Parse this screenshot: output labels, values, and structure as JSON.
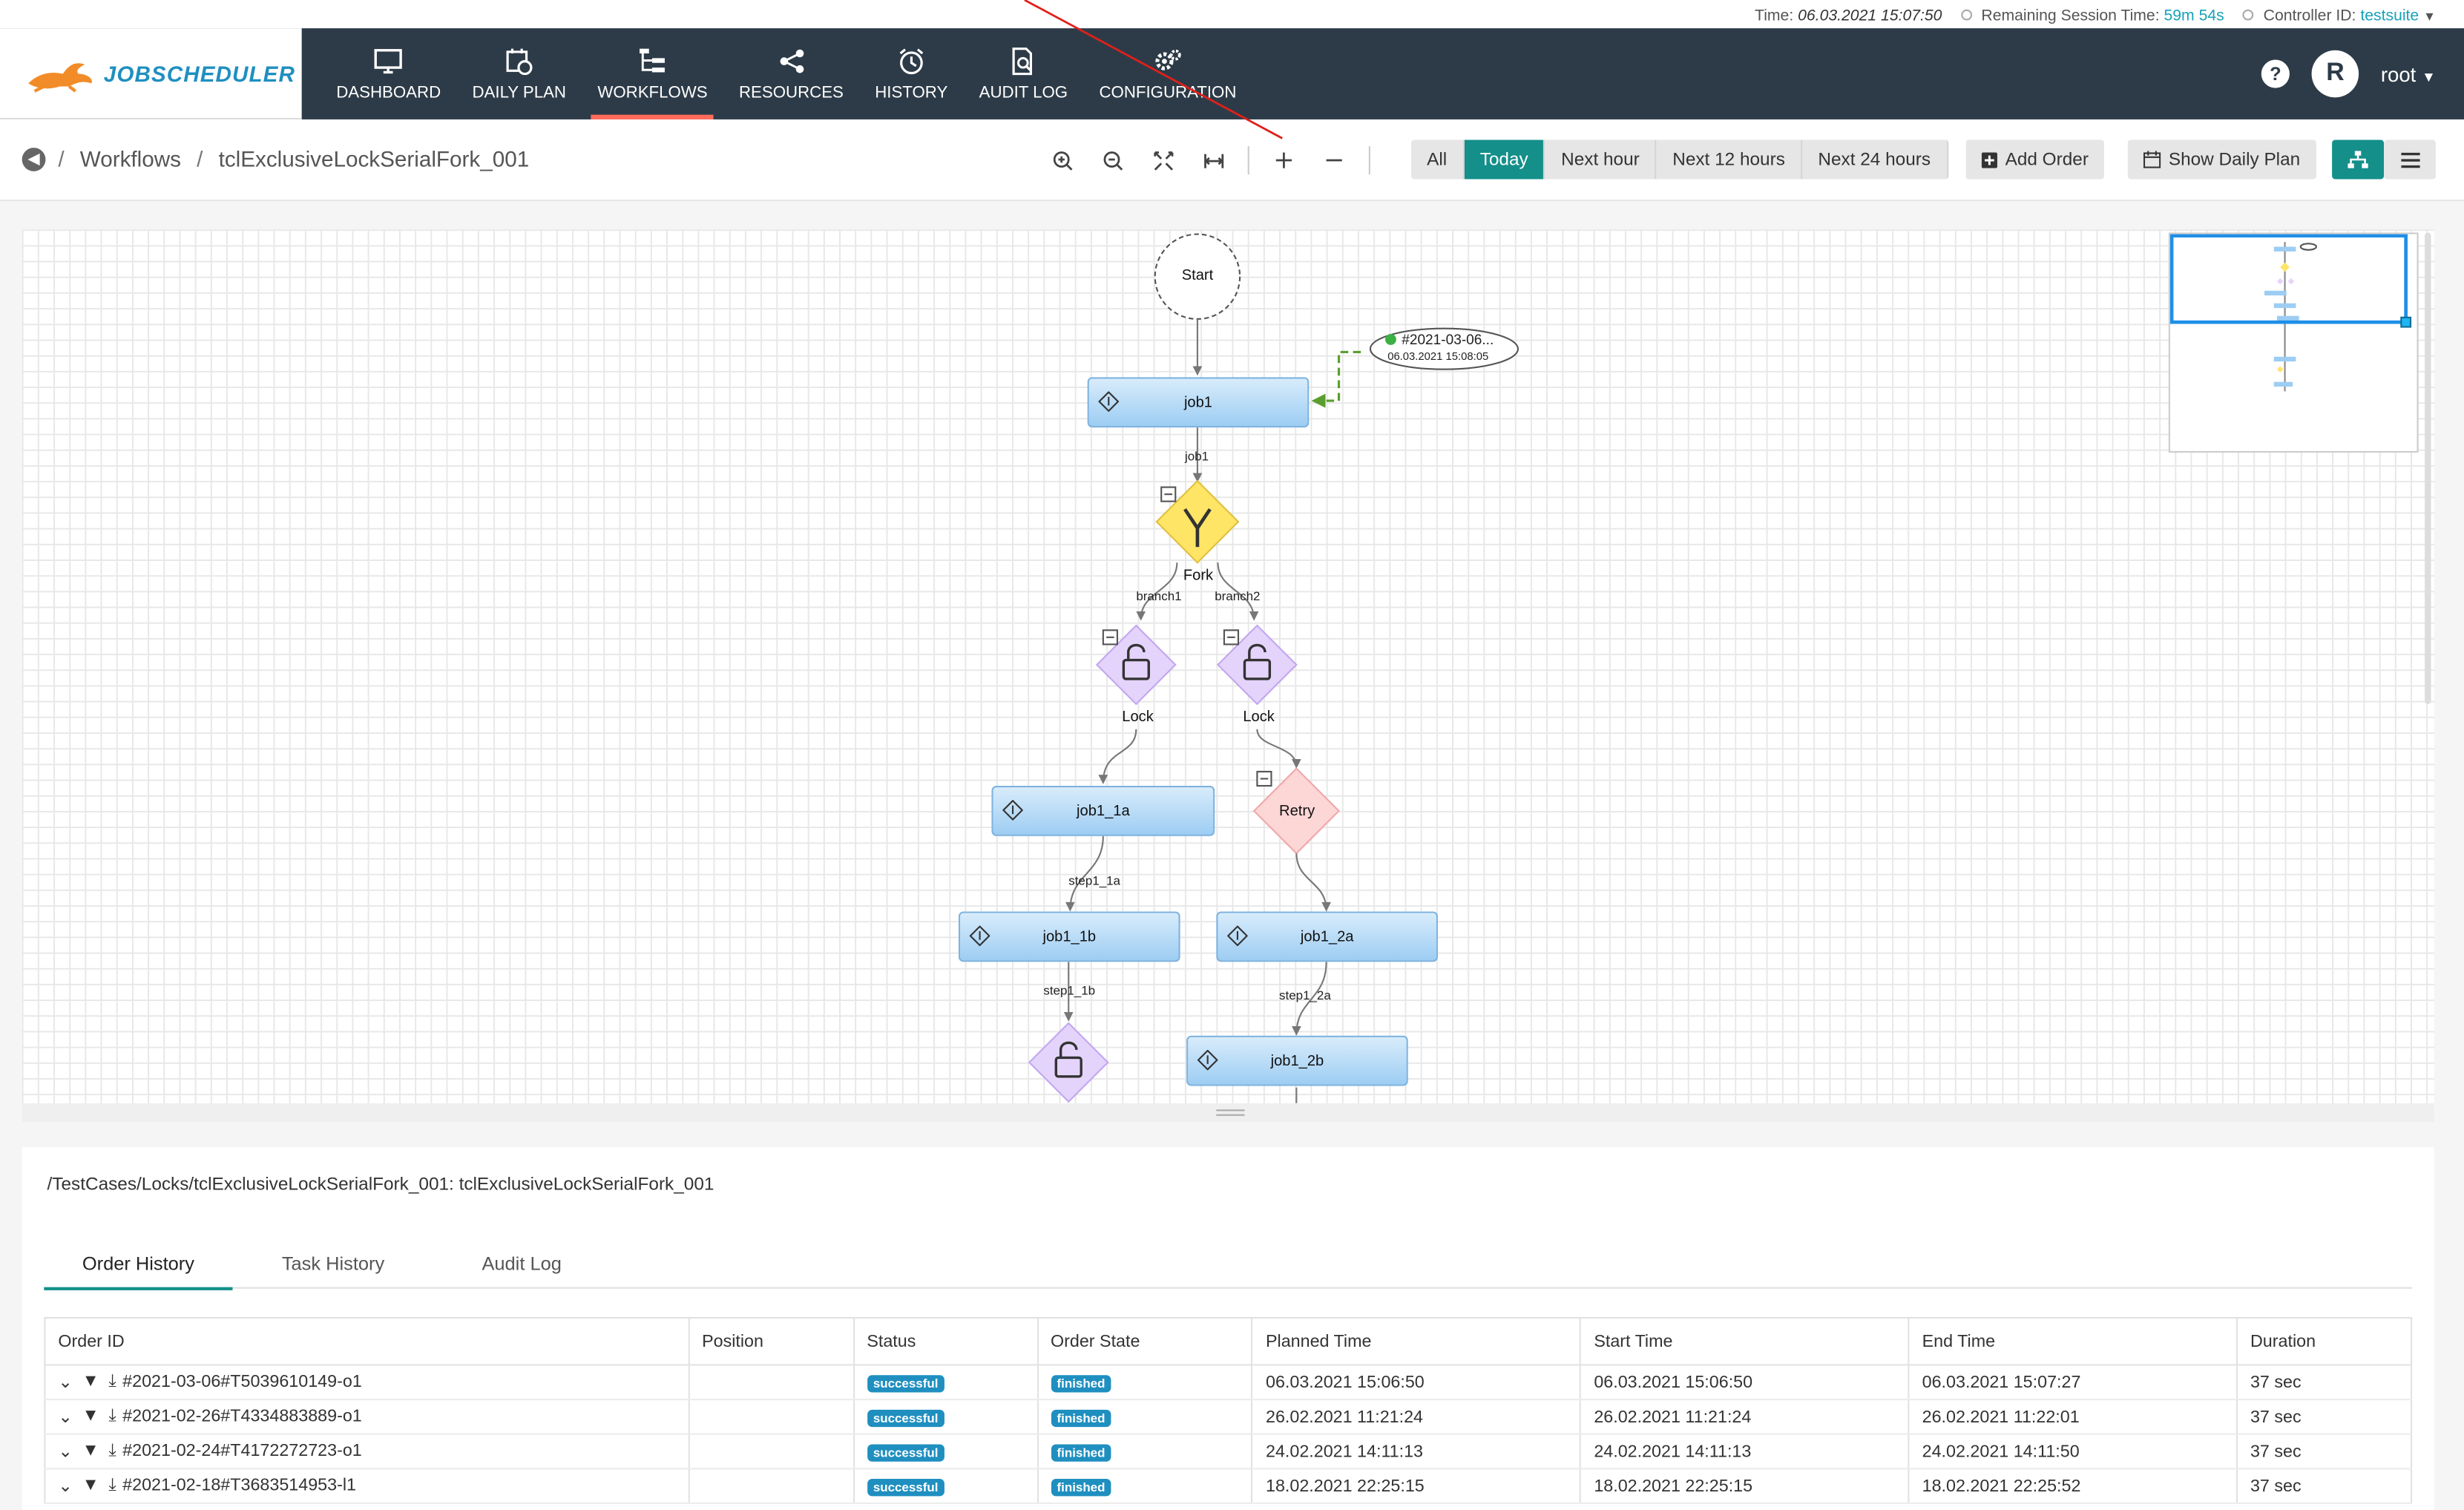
{
  "status_bar": {
    "time_label": "Time:",
    "time_value": "06.03.2021 15:07:50",
    "session_label": "Remaining Session Time:",
    "session_value": "59m 54s",
    "controller_label": "Controller ID:",
    "controller_value": "testsuite"
  },
  "brand": {
    "name": "JOBSCHEDULER",
    "accent": "#f28c28"
  },
  "nav": {
    "items": [
      {
        "label": "DASHBOARD",
        "icon": "monitor-icon"
      },
      {
        "label": "DAILY PLAN",
        "icon": "calendar-clock-icon"
      },
      {
        "label": "WORKFLOWS",
        "icon": "workflow-tree-icon",
        "active": true
      },
      {
        "label": "RESOURCES",
        "icon": "share-nodes-icon"
      },
      {
        "label": "HISTORY",
        "icon": "alarm-clock-icon"
      },
      {
        "label": "AUDIT LOG",
        "icon": "file-search-icon"
      },
      {
        "label": "CONFIGURATION",
        "icon": "gears-icon"
      }
    ],
    "help": "?",
    "avatar_initial": "R",
    "user": "root"
  },
  "breadcrumb": {
    "root": "Workflows",
    "current": "tclExclusiveLockSerialFork_001",
    "sep": "/"
  },
  "filters": [
    "All",
    "Today",
    "Next hour",
    "Next 12 hours",
    "Next 24 hours"
  ],
  "active_filter": "Today",
  "buttons": {
    "add_order": "Add Order",
    "show_daily_plan": "Show Daily Plan"
  },
  "graph": {
    "start": "Start",
    "order_id": "#2021-03-06...",
    "order_time": "06.03.2021 15:08:05",
    "jobs": {
      "job1": "job1",
      "job1_1a": "job1_1a",
      "job1_1b": "job1_1b",
      "job1_2a": "job1_2a",
      "job1_2b": "job1_2b"
    },
    "labels": {
      "edge_job1": "job1",
      "fork": "Fork",
      "branch1": "branch1",
      "branch2": "branch2",
      "lock1": "Lock",
      "lock2": "Lock",
      "retry": "Retry",
      "step1_1a": "step1_1a",
      "step1_1b": "step1_1b",
      "step1_2a": "step1_2a"
    }
  },
  "panel": {
    "path": "/TestCases/Locks/tclExclusiveLockSerialFork_001: tclExclusiveLockSerialFork_001",
    "tabs": [
      "Order History",
      "Task History",
      "Audit Log"
    ],
    "columns": [
      "Order ID",
      "Position",
      "Status",
      "Order State",
      "Planned Time",
      "Start Time",
      "End Time",
      "Duration"
    ],
    "rows": [
      {
        "id": "#2021-03-06#T5039610149-o1",
        "position": "",
        "status": "successful",
        "state": "finished",
        "planned": "06.03.2021 15:06:50",
        "start": "06.03.2021 15:06:50",
        "end": "06.03.2021 15:07:27",
        "duration": "37 sec"
      },
      {
        "id": "#2021-02-26#T4334883889-o1",
        "position": "",
        "status": "successful",
        "state": "finished",
        "planned": "26.02.2021 11:21:24",
        "start": "26.02.2021 11:21:24",
        "end": "26.02.2021 11:22:01",
        "duration": "37 sec"
      },
      {
        "id": "#2021-02-24#T4172272723-o1",
        "position": "",
        "status": "successful",
        "state": "finished",
        "planned": "24.02.2021 14:11:13",
        "start": "24.02.2021 14:11:13",
        "end": "24.02.2021 14:11:50",
        "duration": "37 sec"
      },
      {
        "id": "#2021-02-18#T3683514953-l1",
        "position": "",
        "status": "successful",
        "state": "finished",
        "planned": "18.02.2021 22:25:15",
        "start": "18.02.2021 22:25:15",
        "end": "18.02.2021 22:25:52",
        "duration": "37 sec"
      }
    ]
  },
  "colors": {
    "nav_bg": "#2d3b48",
    "teal": "#148f8a",
    "active_underline": "#ff6b5a",
    "job_fill": "#9dcdf3",
    "badge": "#1f8fc0"
  }
}
